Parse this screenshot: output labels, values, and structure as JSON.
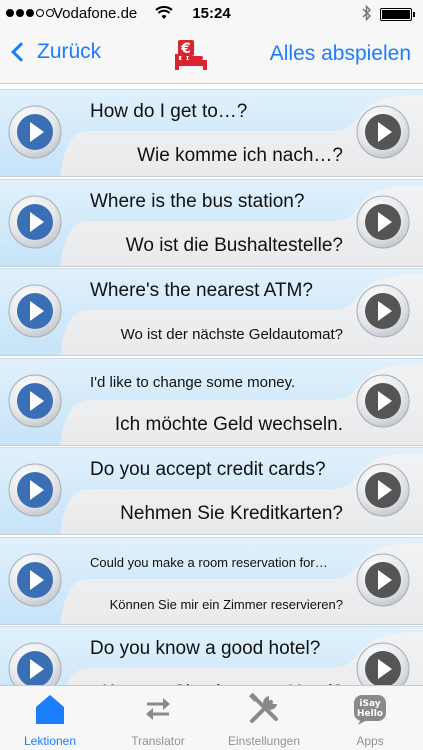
{
  "status_bar": {
    "carrier": "Vodafone.de",
    "time": "15:24",
    "battery_level": 1.0
  },
  "nav": {
    "back_label": "Zurück",
    "play_all_label": "Alles abspielen",
    "logo_icon": "euro-bed-icon"
  },
  "phrases": [
    {
      "en": "How do I get to…?",
      "de": "Wie komme ich nach…?"
    },
    {
      "en": "Where is the bus station?",
      "de": "Wo ist die Bushaltestelle?"
    },
    {
      "en": "Where's the nearest ATM?",
      "de": "Wo ist der nächste Geldautomat?"
    },
    {
      "en": "I'd like to change some money.",
      "de": "Ich möchte Geld wechseln."
    },
    {
      "en": "Do you accept credit cards?",
      "de": "Nehmen Sie Kreditkarten?"
    },
    {
      "en": "Could you make a room reservation for…",
      "de": "Können Sie mir ein Zimmer reservieren?"
    },
    {
      "en": "Do you know a good hotel?",
      "de": "Kennen Sie ein gutes Hotel?"
    }
  ],
  "tabs": [
    {
      "label": "Lektionen",
      "icon": "house-icon",
      "active": true
    },
    {
      "label": "Translator",
      "icon": "arrows-swap-icon",
      "active": false
    },
    {
      "label": "Einstellungen",
      "icon": "tools-icon",
      "active": false
    },
    {
      "label": "Apps",
      "icon": "isayhello-icon",
      "active": false
    }
  ],
  "tab_icon_text": {
    "apps_line1": "iSay",
    "apps_line2": "Hello"
  },
  "colors": {
    "accent": "#1c7dfa",
    "cell_top": "#c6e3f8",
    "cell_bottom": "#e9eaec",
    "play_left": "#3a6fb6",
    "play_right": "#555555",
    "tab_inactive": "#929292"
  }
}
